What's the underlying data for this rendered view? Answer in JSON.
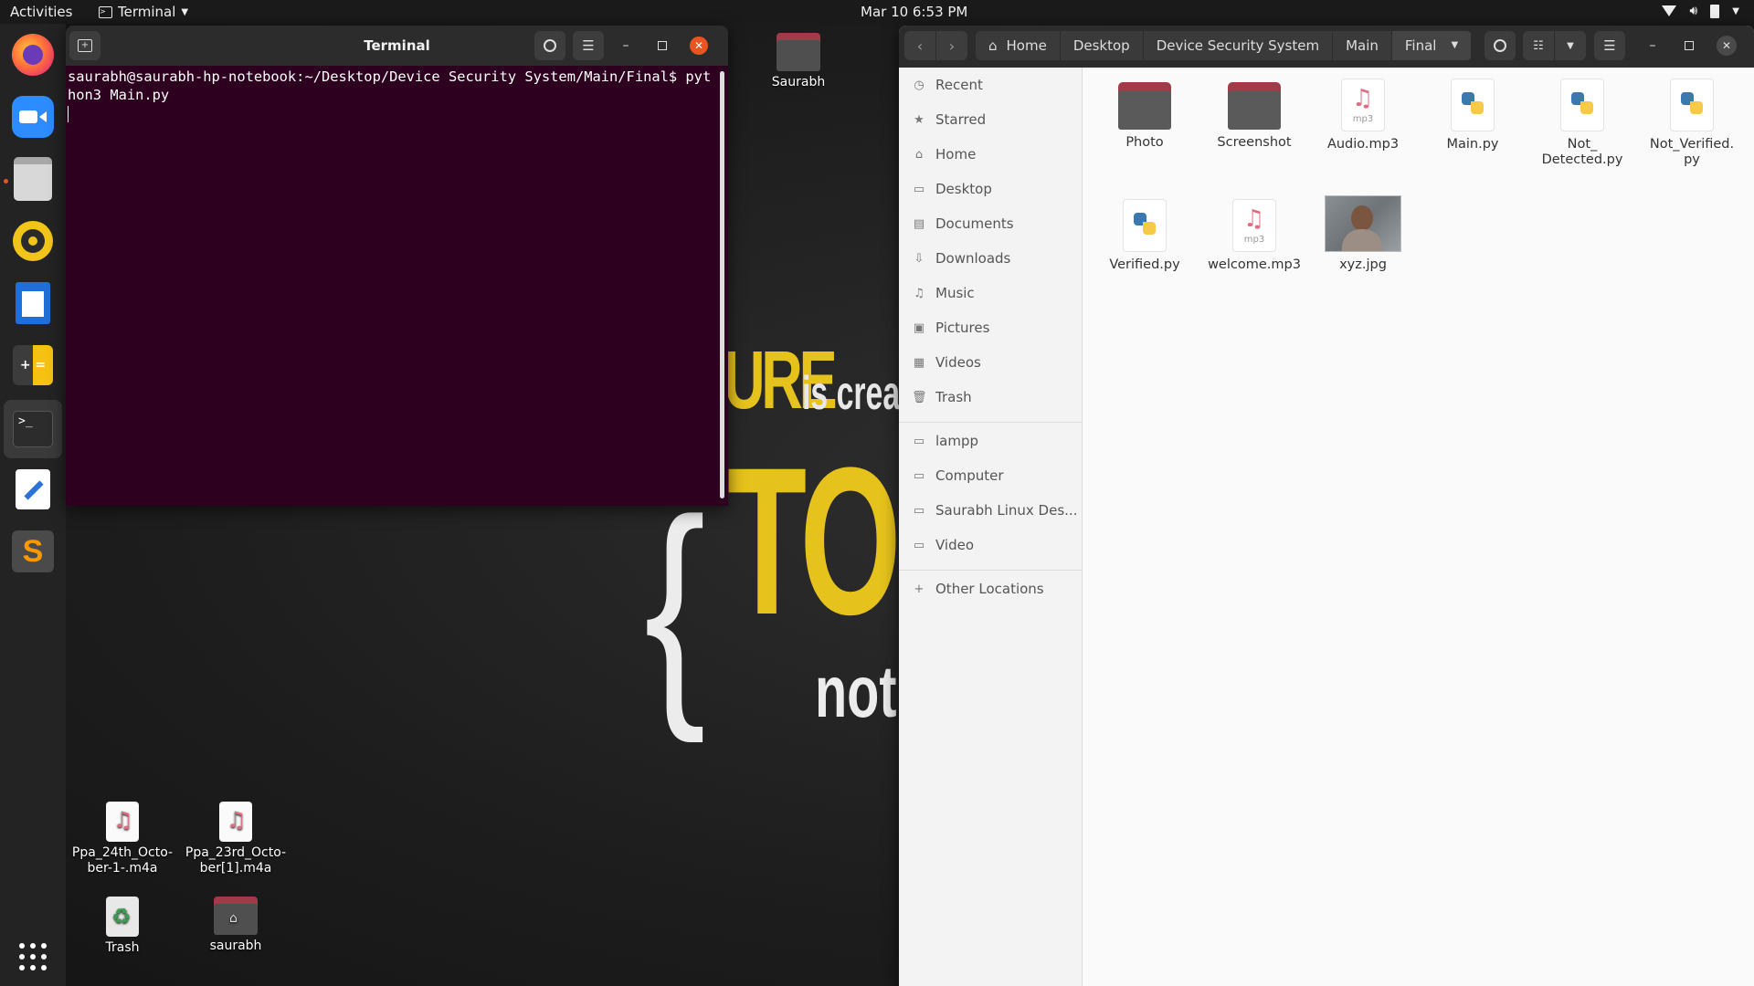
{
  "topbar": {
    "activities": "Activities",
    "app_menu": "Terminal",
    "clock": "Mar 10  6:53 PM"
  },
  "wallpaper": {
    "fragment1": "URE",
    "fragment2": "is creat",
    "fragment3": "TO",
    "fragment4": "{",
    "fragment5": "not"
  },
  "dock": {
    "items": [
      "Firefox",
      "Zoom",
      "Files",
      "Rhythmbox",
      "LibreOffice Writer",
      "Calculator",
      "Terminal",
      "Text Editor",
      "Sublime Text"
    ]
  },
  "desktop": {
    "icons": [
      {
        "label": "Saurabh"
      },
      {
        "label": "Ppa_24th_Octo-\nber-1-.m4a"
      },
      {
        "label": "Ppa_23rd_Octo-\nber[1].m4a"
      },
      {
        "label": "Trash"
      },
      {
        "label": "saurabh"
      }
    ]
  },
  "terminal": {
    "title": "Terminal",
    "prompt": "saurabh@saurabh-hp-notebook:~/Desktop/Device Security System/Main/Final$ python3 Main.py"
  },
  "files": {
    "breadcrumbs": [
      "Home",
      "Desktop",
      "Device Security System",
      "Main",
      "Final"
    ],
    "sidebar": [
      {
        "label": "Recent",
        "icon": "clock-icon"
      },
      {
        "label": "Starred",
        "icon": "star-icon"
      },
      {
        "label": "Home",
        "icon": "home-icon"
      },
      {
        "label": "Desktop",
        "icon": "desktop-icon"
      },
      {
        "label": "Documents",
        "icon": "document-icon"
      },
      {
        "label": "Downloads",
        "icon": "download-icon"
      },
      {
        "label": "Music",
        "icon": "music-icon"
      },
      {
        "label": "Pictures",
        "icon": "picture-icon"
      },
      {
        "label": "Videos",
        "icon": "video-icon"
      },
      {
        "label": "Trash",
        "icon": "trash-icon"
      },
      {
        "label": "lampp",
        "icon": "folder-icon"
      },
      {
        "label": "Computer",
        "icon": "folder-icon"
      },
      {
        "label": "Saurabh Linux Des...",
        "icon": "folder-icon"
      },
      {
        "label": "Video",
        "icon": "folder-icon"
      },
      {
        "label": "Other Locations",
        "icon": "plus-icon"
      }
    ],
    "items": [
      {
        "name": "Photo",
        "type": "folder"
      },
      {
        "name": "Screenshot",
        "type": "folder"
      },
      {
        "name": "Audio.mp3",
        "type": "mp3"
      },
      {
        "name": "Main.py",
        "type": "python"
      },
      {
        "name": "Not_\nDetected.py",
        "type": "python"
      },
      {
        "name": "Not_Verified.\npy",
        "type": "python"
      },
      {
        "name": "Verified.py",
        "type": "python"
      },
      {
        "name": "welcome.mp3",
        "type": "mp3"
      },
      {
        "name": "xyz.jpg",
        "type": "image"
      }
    ],
    "mp3_ext": "mp3"
  },
  "colors": {
    "terminal_bg": "#2c001e",
    "accent": "#e95420",
    "folder": "#a23a4a"
  }
}
